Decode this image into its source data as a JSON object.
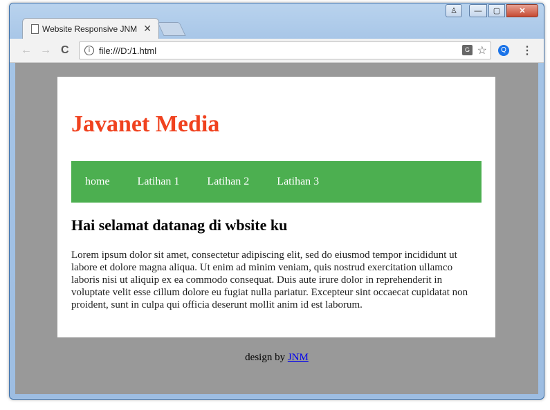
{
  "browser": {
    "tab_title": "Website Responsive JNM",
    "tab_close": "✕",
    "address": "file:///D:/1.html",
    "info_glyph": "i",
    "translate_glyph": "G",
    "star_glyph": "☆",
    "back_glyph": "←",
    "forward_glyph": "→",
    "reload_glyph": "C",
    "menu_glyph": "⋮",
    "extension_glyph": "Q",
    "window_buttons": {
      "minimize": "—",
      "maximize": "▢",
      "close": "✕",
      "user": "♙"
    }
  },
  "page": {
    "title": "Javanet Media",
    "title_color": "#f0421f",
    "nav_color": "#4caf50",
    "nav": [
      "home",
      "Latihan 1",
      "Latihan 2",
      "Latihan 3"
    ],
    "heading": "Hai selamat datanag di wbsite ku",
    "paragraph": "Lorem ipsum dolor sit amet, consectetur adipiscing elit, sed do eiusmod tempor incididunt ut labore et dolore magna aliqua. Ut enim ad minim veniam, quis nostrud exercitation ullamco laboris nisi ut aliquip ex ea commodo consequat. Duis aute irure dolor in reprehenderit in voluptate velit esse cillum dolore eu fugiat nulla pariatur. Excepteur sint occaecat cupidatat non proident, sunt in culpa qui officia deserunt mollit anim id est laborum.",
    "footer_prefix": "design by",
    "footer_link": "JNM"
  }
}
